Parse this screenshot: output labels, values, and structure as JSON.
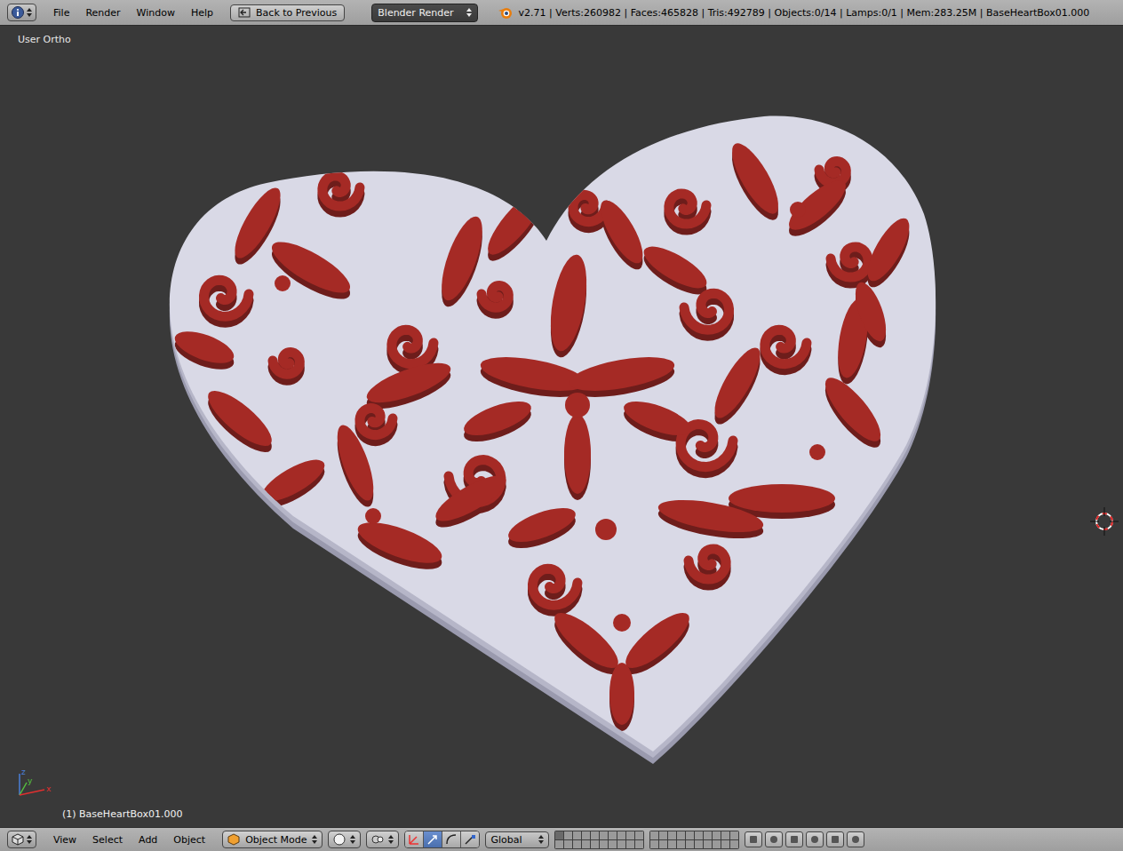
{
  "window": {
    "title": "Blender"
  },
  "top_bar": {
    "menus": [
      "File",
      "Render",
      "Window",
      "Help"
    ],
    "back_button": "Back to Previous",
    "render_engine": "Blender Render",
    "stats": "v2.71 | Verts:260982 | Faces:465828 | Tris:492789 | Objects:0/14 | Lamps:0/1 | Mem:283.25M | BaseHeartBox01.000"
  },
  "viewport": {
    "view_label": "User Ortho",
    "object_label": "(1) BaseHeartBox01.000",
    "axes": [
      "z",
      "y",
      "x"
    ]
  },
  "bottom_bar": {
    "menus": [
      "View",
      "Select",
      "Add",
      "Object"
    ],
    "mode": "Object Mode",
    "orientation": "Global"
  }
}
